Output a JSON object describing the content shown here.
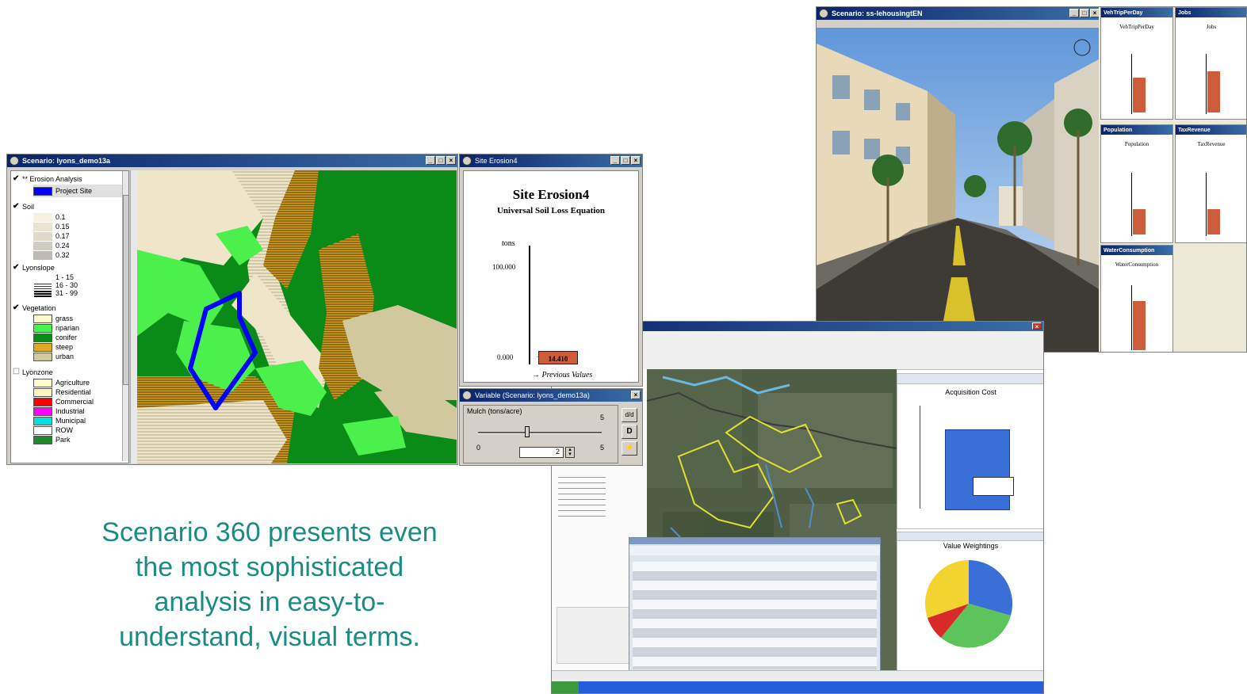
{
  "map_window": {
    "title": "Scenario: lyons_demo13a",
    "legend": {
      "erosion": {
        "label": "** Erosion Analysis",
        "item": "Project Site"
      },
      "soil": {
        "label": "Soil",
        "items": [
          "0.1",
          "0.15",
          "0.17",
          "0.24",
          "0.32"
        ]
      },
      "slope": {
        "label": "Lyonslope",
        "items": [
          "1 - 15",
          "16 - 30",
          "31 - 99"
        ]
      },
      "vegetation": {
        "label": "Vegetation",
        "items": [
          "grass",
          "riparian",
          "conifer",
          "steep",
          "urban"
        ]
      },
      "zone": {
        "label": "Lyonzone",
        "items": [
          "Agriculture",
          "Residential",
          "Commercial",
          "Industrial",
          "Municipal",
          "ROW",
          "Park"
        ]
      }
    }
  },
  "erosion_window": {
    "title": "Site Erosion4",
    "heading": "Site Erosion4",
    "subheading": "Universal Soil Loss Equation",
    "unit": "tons",
    "axis_top": "100.000",
    "axis_bottom": "0.000",
    "bar_value": "14.410",
    "bar_fraction": 0.144,
    "previous_label": "Previous Values"
  },
  "variable_window": {
    "title": "Variable (Scenario: lyons_demo13a)",
    "label": "Mulch (tons/acre)",
    "min": "0",
    "max": "5",
    "max_top": "5",
    "value": "2",
    "slider_fraction": 0.4,
    "buttons": [
      "d/d",
      "D",
      "⚡"
    ]
  },
  "street_window": {
    "title": "Scenario: ss-lehousingtEN",
    "panels": [
      {
        "title": "VehTripPerDay",
        "label": "VehTripPerDay"
      },
      {
        "title": "Jobs",
        "label": "Jobs"
      },
      {
        "title": "Population",
        "label": "Population"
      },
      {
        "title": "TaxRevenue",
        "label": "TaxRevenue"
      },
      {
        "title": "WaterConsumption",
        "label": "WaterConsumption"
      }
    ]
  },
  "gis_window": {
    "bar_chart_title": "Acquisition Cost",
    "pie_chart_title": "Value Weightings"
  },
  "caption": {
    "line1": "Scenario 360 presents even",
    "line2": "the most sophisticated",
    "line3": "analysis in easy-to-",
    "line4": "understand, visual terms."
  },
  "colors": {
    "title_bar": "#0a246a",
    "caption": "#1a8c82",
    "project_site": "#0000ff",
    "bar": "#cc5c3a"
  }
}
